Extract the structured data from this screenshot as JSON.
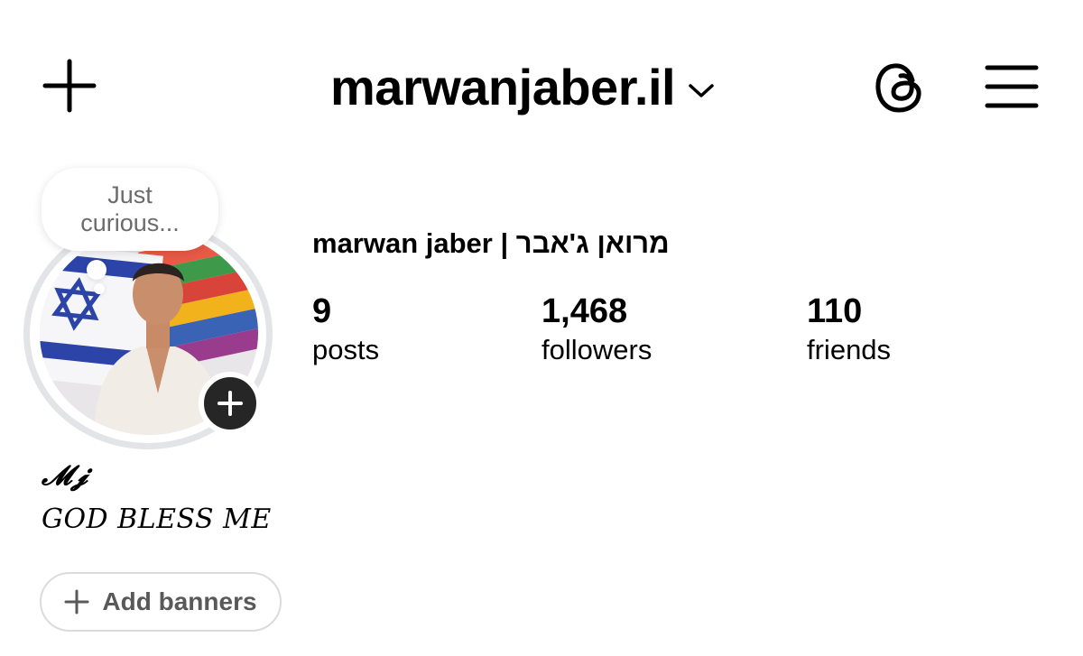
{
  "header": {
    "username": "marwanjaber.il",
    "icons": {
      "create": "plus-icon",
      "account_switch": "chevron-down-icon",
      "threads": "threads-icon",
      "menu": "hamburger-menu-icon"
    }
  },
  "profile": {
    "note": "Just curious...",
    "full_name": "marwan jaber | מרואן ג'אבר",
    "stats": [
      {
        "value": "9",
        "label": "posts"
      },
      {
        "value": "1,468",
        "label": "followers"
      },
      {
        "value": "110",
        "label": "friends"
      }
    ],
    "bio_title": "𝓜𝓳",
    "bio_line": "GOD BLESS ME",
    "add_banners_label": "Add banners"
  },
  "colors": {
    "text": "#000000",
    "muted": "#6b6b6b",
    "ring": "#e3e4e8",
    "add_story_bg": "#262626"
  }
}
